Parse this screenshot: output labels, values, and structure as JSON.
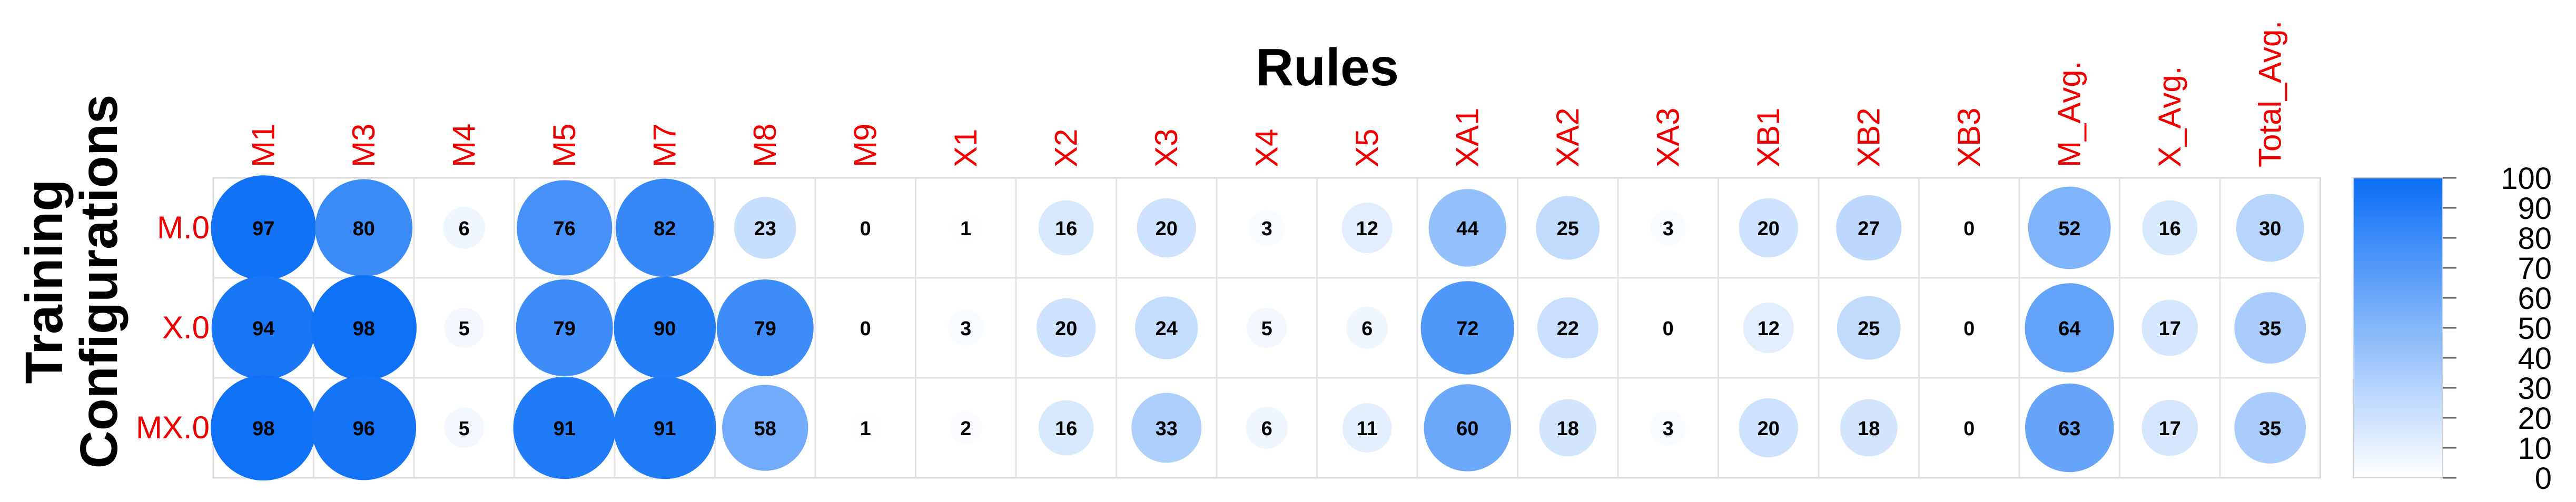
{
  "chart_data": {
    "type": "heatmap",
    "title": "Rules",
    "ylabel": "Training Configurations",
    "ylabel_lines": [
      "Training",
      "Configurations"
    ],
    "columns": [
      "M1",
      "M3",
      "M4",
      "M5",
      "M7",
      "M8",
      "M9",
      "X1",
      "X2",
      "X3",
      "X4",
      "X5",
      "XA1",
      "XA2",
      "XA3",
      "XB1",
      "XB2",
      "XB3",
      "M_Avg.",
      "X_Avg.",
      "Total_Avg."
    ],
    "rows": [
      "M.0",
      "X.0",
      "MX.0"
    ],
    "values": [
      [
        97,
        80,
        6,
        76,
        82,
        23,
        0,
        1,
        16,
        20,
        3,
        12,
        44,
        25,
        3,
        20,
        27,
        0,
        52,
        16,
        30
      ],
      [
        94,
        98,
        5,
        79,
        90,
        79,
        0,
        3,
        20,
        24,
        5,
        6,
        72,
        22,
        0,
        12,
        25,
        0,
        64,
        17,
        35
      ],
      [
        98,
        96,
        5,
        91,
        91,
        58,
        1,
        2,
        16,
        33,
        6,
        11,
        60,
        18,
        3,
        20,
        18,
        0,
        63,
        17,
        35
      ]
    ],
    "colorbar": {
      "range": [
        0,
        100
      ],
      "ticks": [
        100,
        90,
        80,
        70,
        60,
        50,
        40,
        30,
        20,
        10,
        0
      ],
      "color_low": "#ffffff",
      "color_high": "#0a6ef5"
    },
    "label_color": "#ee0000",
    "grid": true,
    "marker": "circle sized and colored by value"
  }
}
